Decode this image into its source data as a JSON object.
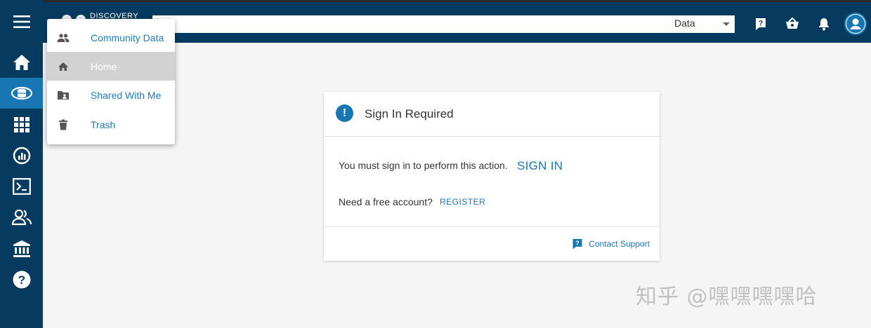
{
  "brand": {
    "name": "DISCOVERY"
  },
  "search": {
    "value": "",
    "placeholder": ""
  },
  "scope_select": {
    "value": "Data"
  },
  "top_actions": [
    {
      "name": "help",
      "icon": "help-icon"
    },
    {
      "name": "cart",
      "icon": "cart-icon"
    },
    {
      "name": "notifications",
      "icon": "bell-icon"
    },
    {
      "name": "account",
      "icon": "account-icon"
    }
  ],
  "sidebar": {
    "items": [
      {
        "icon": "home-icon",
        "active": false
      },
      {
        "icon": "data-icon",
        "active": true
      },
      {
        "icon": "apps-icon",
        "active": false
      },
      {
        "icon": "analytics-icon",
        "active": false
      },
      {
        "icon": "terminal-icon",
        "active": false
      },
      {
        "icon": "teams-icon",
        "active": false
      },
      {
        "icon": "institution-icon",
        "active": false
      },
      {
        "icon": "help-icon",
        "active": false
      }
    ]
  },
  "dropdown": {
    "items": [
      {
        "label": "Community Data",
        "icon": "people-icon"
      },
      {
        "label": "Home",
        "icon": "home-icon"
      },
      {
        "label": "Shared With Me",
        "icon": "shared-folder-icon"
      },
      {
        "label": "Trash",
        "icon": "trash-icon"
      }
    ],
    "selected_index": 1
  },
  "card": {
    "title": "Sign In Required",
    "message": "You must sign in to perform this action.",
    "signin_label": "SIGN IN",
    "need_account": "Need a free account?",
    "register_label": "REGISTER",
    "support_label": "Contact Support"
  },
  "watermark": "知乎 @嘿嘿嘿嘿哈",
  "colors": {
    "appbar": "#063b5f",
    "accent": "#1876b3",
    "selected": "#d2d2d2"
  }
}
